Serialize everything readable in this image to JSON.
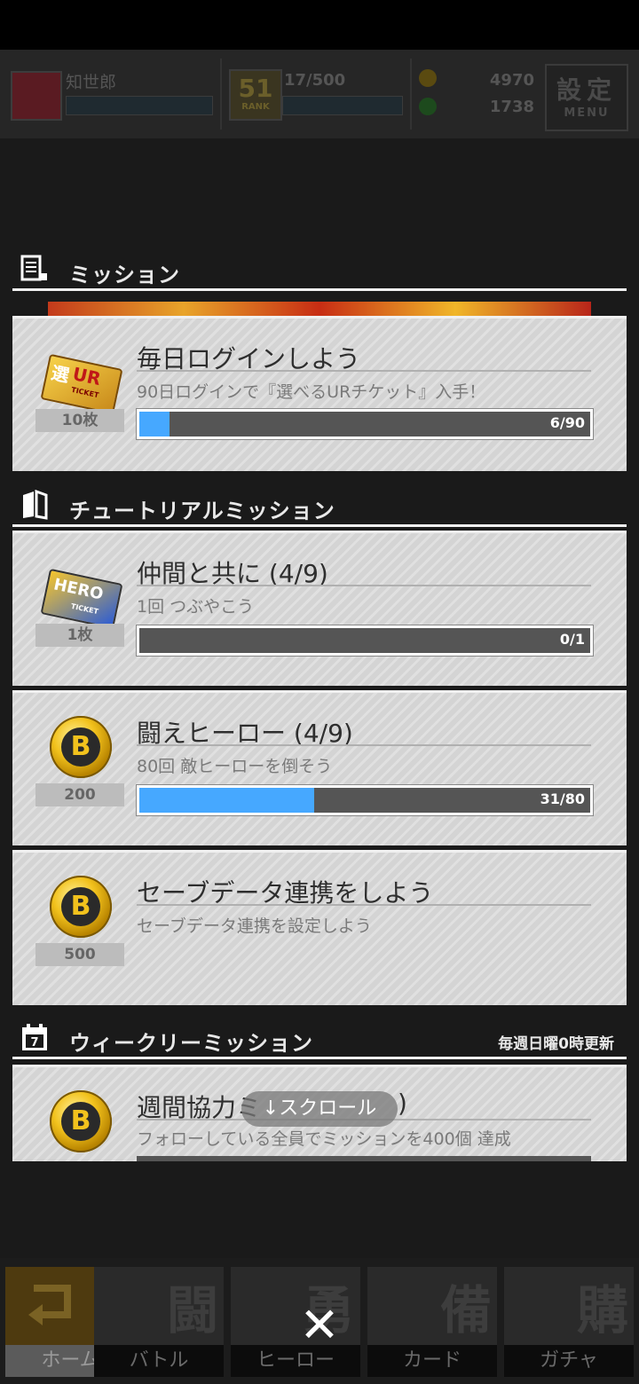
{
  "header": {
    "player_name": "知世郎",
    "rank_number": "51",
    "rank_label": "RANK",
    "exp": "17/500",
    "currency_1": "4970",
    "currency_2": "1738",
    "menu_kanji": "設定",
    "menu_label": "MENU"
  },
  "sections": {
    "mission": {
      "title": "ミッション"
    },
    "tutorial": {
      "title": "チュートリアルミッション"
    },
    "weekly": {
      "title": "ウィークリーミッション",
      "note": "毎週日曜0時更新"
    }
  },
  "missions": [
    {
      "title": "毎日ログインしよう",
      "desc": "90日ログインで『選べるURチケット』入手！",
      "reward": "10枚",
      "reward_icon": "ur-ticket-icon",
      "progress_text": "6/90",
      "progress": 0.0667
    },
    {
      "title": "仲間と共に (4/9)",
      "desc": "1回 つぶやこう",
      "reward": "1枚",
      "reward_icon": "hero-ticket-icon",
      "progress_text": "0/1",
      "progress": 0
    },
    {
      "title": "闘えヒーロー (4/9)",
      "desc": "80回 敵ヒーローを倒そう",
      "reward": "200",
      "reward_icon": "coin-icon",
      "progress_text": "31/80",
      "progress": 0.3875
    },
    {
      "title": "セーブデータ連携をしよう",
      "desc": "セーブデータ連携を設定しよう",
      "reward": "500",
      "reward_icon": "coin-icon"
    },
    {
      "title": "週間協力ミ",
      "title_tail": ")",
      "desc": "フォローしている全員でミッションを400個 達成",
      "reward_icon": "coin-icon"
    }
  ],
  "ticket_text": {
    "ur_top": "選",
    "ur_main": "UR",
    "ur_sub": "TICKET",
    "hero_main": "HERO",
    "hero_sub": "TICKET"
  },
  "coin_letter": "B",
  "scroll_hint": "↓スクロール",
  "close_symbol": "✕",
  "nav": [
    {
      "label": "ホーム",
      "kanji": ""
    },
    {
      "label": "バトル",
      "kanji": "闘"
    },
    {
      "label": "ヒーロー",
      "kanji": "勇"
    },
    {
      "label": "カード",
      "kanji": "備"
    },
    {
      "label": "ガチャ",
      "kanji": "購"
    }
  ],
  "colors": {
    "progress_fill": "#46a8ff",
    "accent_gold": "#f2c21d"
  }
}
